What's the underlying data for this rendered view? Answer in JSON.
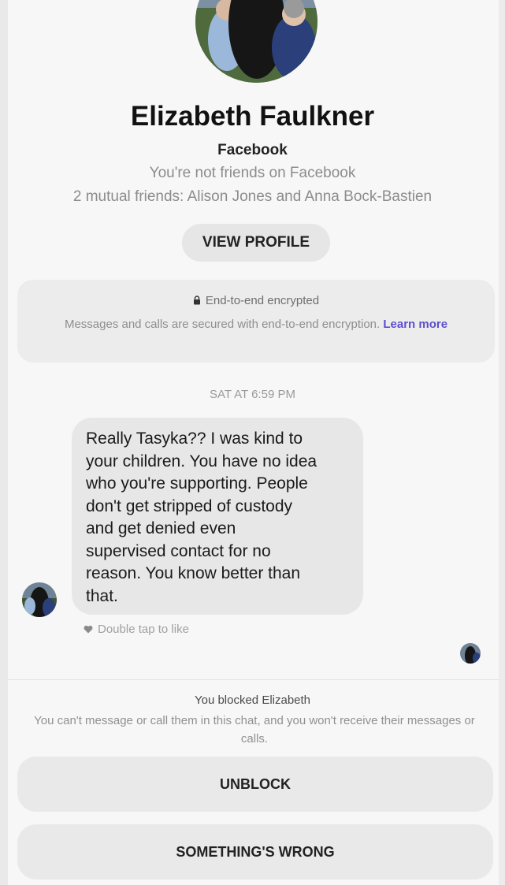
{
  "profile": {
    "name": "Elizabeth Faulkner",
    "platform": "Facebook",
    "friend_status": "You're not friends on Facebook",
    "mutual_friends": "2 mutual friends: Alison Jones and Anna Bock-Bastien",
    "view_profile_label": "VIEW PROFILE"
  },
  "encryption": {
    "title": "End-to-end encrypted",
    "description": "Messages and calls are secured with end-to-end encryption.",
    "learn_more": "Learn more",
    "icon": "lock-icon"
  },
  "conversation": {
    "timestamp": "SAT AT 6:59 PM",
    "messages": [
      {
        "sender": "Elizabeth Faulkner",
        "text": "Really Tasyka??  I was kind to\nyour children. You have no idea\nwho you're supporting. People\ndon't get stripped of custody\nand get denied even\nsupervised contact for no\nreason. You know better than\nthat."
      }
    ],
    "like_hint": "Double tap to like"
  },
  "blocked": {
    "title": "You blocked Elizabeth",
    "description": "You can't message or call them in this chat, and you won't receive their messages or calls.",
    "unblock_label": "UNBLOCK",
    "report_label": "SOMETHING'S WRONG"
  },
  "colors": {
    "link": "#5b4fd0",
    "bubble": "#e7e7e7",
    "button": "#e9e9e9"
  }
}
